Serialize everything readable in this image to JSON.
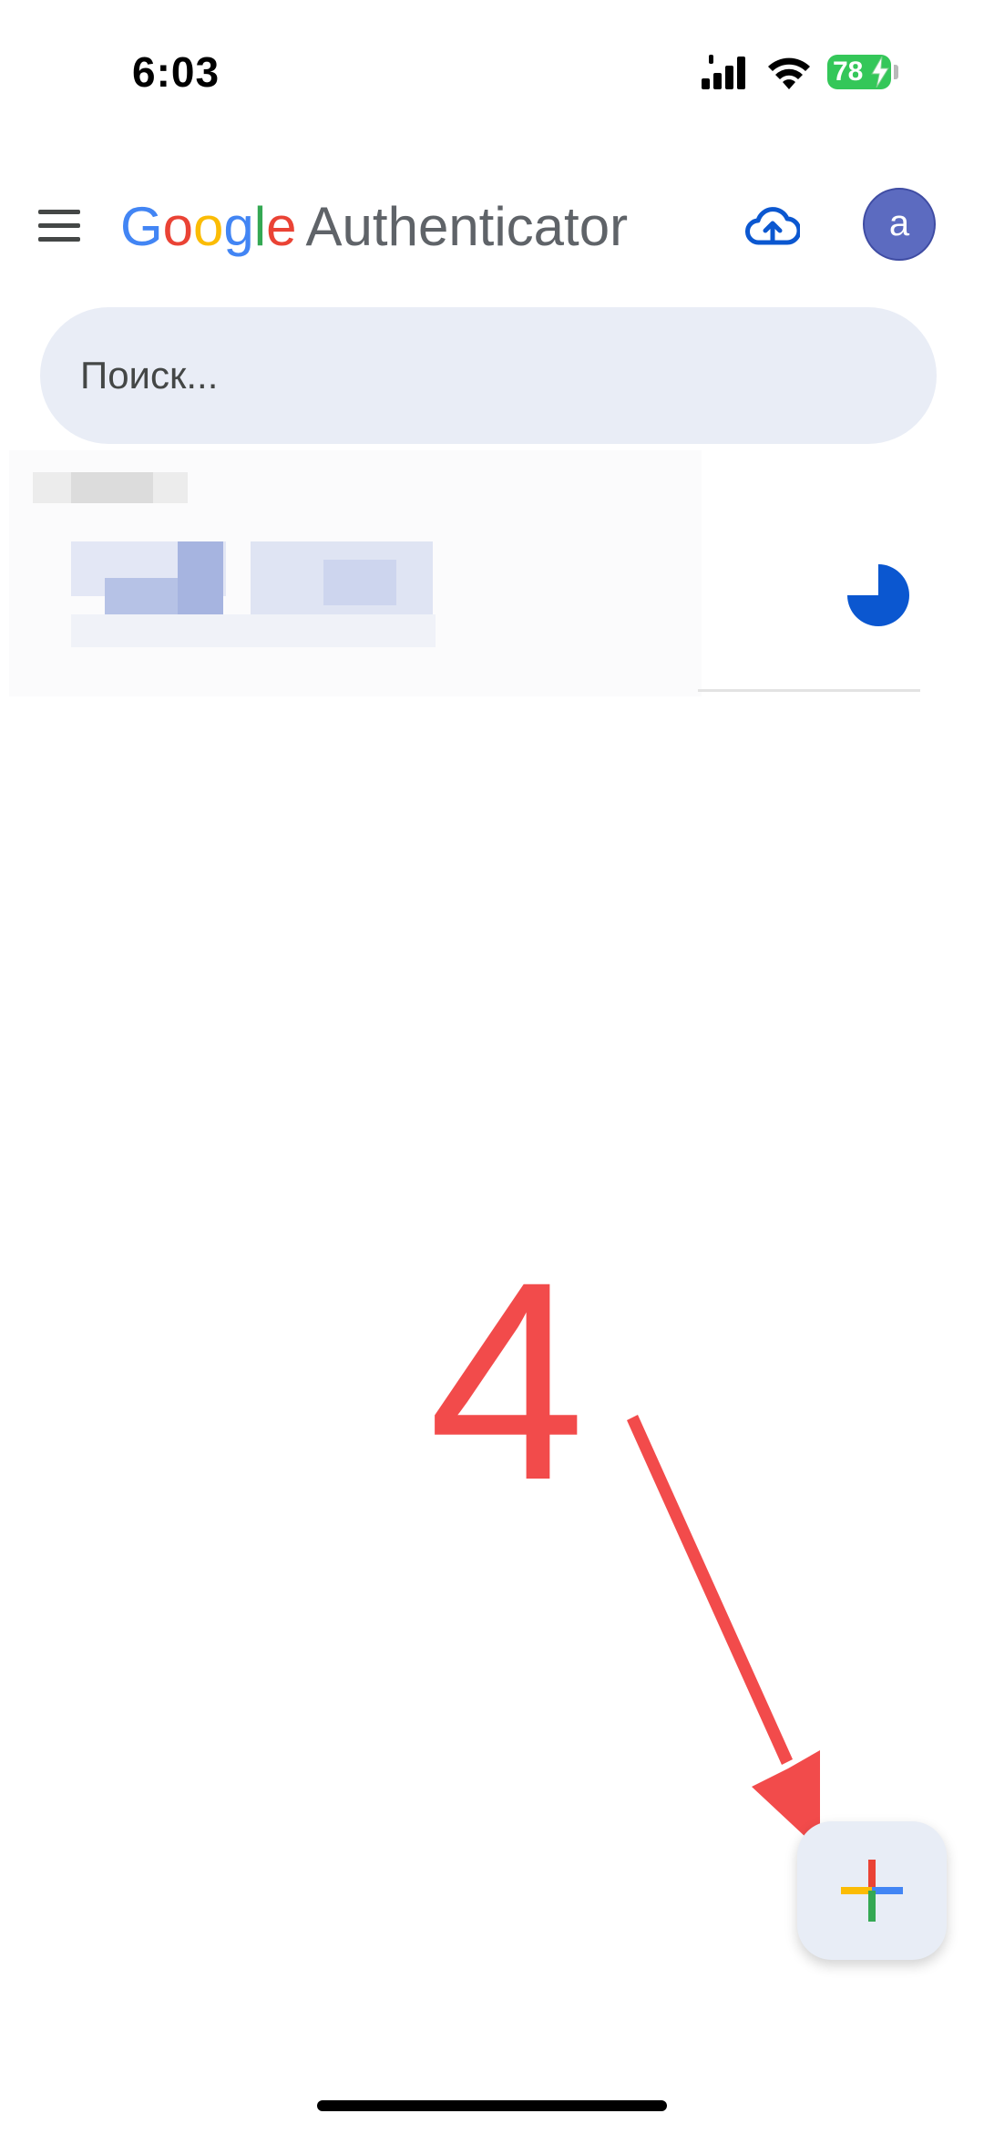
{
  "status_bar": {
    "time": "6:03",
    "battery_level": "78",
    "icons": [
      "signal-icon",
      "wifi-icon",
      "battery-icon",
      "charging-bolt-icon"
    ]
  },
  "app_bar": {
    "brand_letters": [
      "G",
      "o",
      "o",
      "g",
      "l",
      "e"
    ],
    "app_name": "Authenticator",
    "icons": [
      "menu-icon",
      "cloud-upload-icon"
    ],
    "avatar_letter": "a"
  },
  "search": {
    "placeholder": "Поиск..."
  },
  "account_list": {
    "items": [
      {
        "blurred": true,
        "timer_icon": "countdown-timer-icon",
        "timer_remaining_fraction": 0.75
      }
    ]
  },
  "annotation": {
    "step_number": "4",
    "arrow_icon": "red-arrow-icon"
  },
  "fab": {
    "icon": "plus-icon",
    "colors": [
      "#EA4335",
      "#4285F4",
      "#FBBC05",
      "#34A853"
    ]
  },
  "colors": {
    "accent_blue": "#0b57d0",
    "search_bg": "#e9edf6",
    "avatar_bg": "#5c6bc0",
    "annotation_red": "#f24b4b",
    "battery_green": "#34c759"
  }
}
